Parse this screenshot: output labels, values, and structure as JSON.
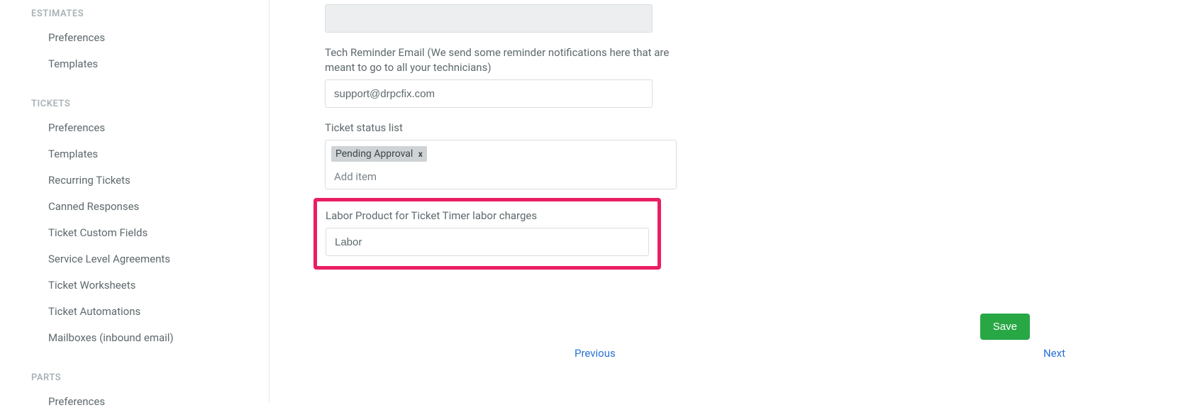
{
  "sidebar": {
    "sections": {
      "estimates": {
        "header": "ESTIMATES",
        "items": [
          "Preferences",
          "Templates"
        ]
      },
      "tickets": {
        "header": "TICKETS",
        "items": [
          "Preferences",
          "Templates",
          "Recurring Tickets",
          "Canned Responses",
          "Ticket Custom Fields",
          "Service Level Agreements",
          "Ticket Worksheets",
          "Ticket Automations",
          "Mailboxes (inbound email)"
        ]
      },
      "parts": {
        "header": "PARTS",
        "items": [
          "Preferences"
        ]
      }
    }
  },
  "form": {
    "tech_reminder_label": "Tech Reminder Email (We send some reminder notifications here that are meant to go to all your technicians)",
    "tech_reminder_value": "support@drpcfix.com",
    "ticket_status_label": "Ticket status list",
    "ticket_status_items": [
      {
        "label": "Pending Approval"
      }
    ],
    "add_item_placeholder": "Add item",
    "labor_product_label": "Labor Product for Ticket Timer labor charges",
    "labor_product_value": "Labor"
  },
  "buttons": {
    "save": "Save",
    "previous": "Previous",
    "next": "Next"
  },
  "highlight_color": "#ea1e63"
}
